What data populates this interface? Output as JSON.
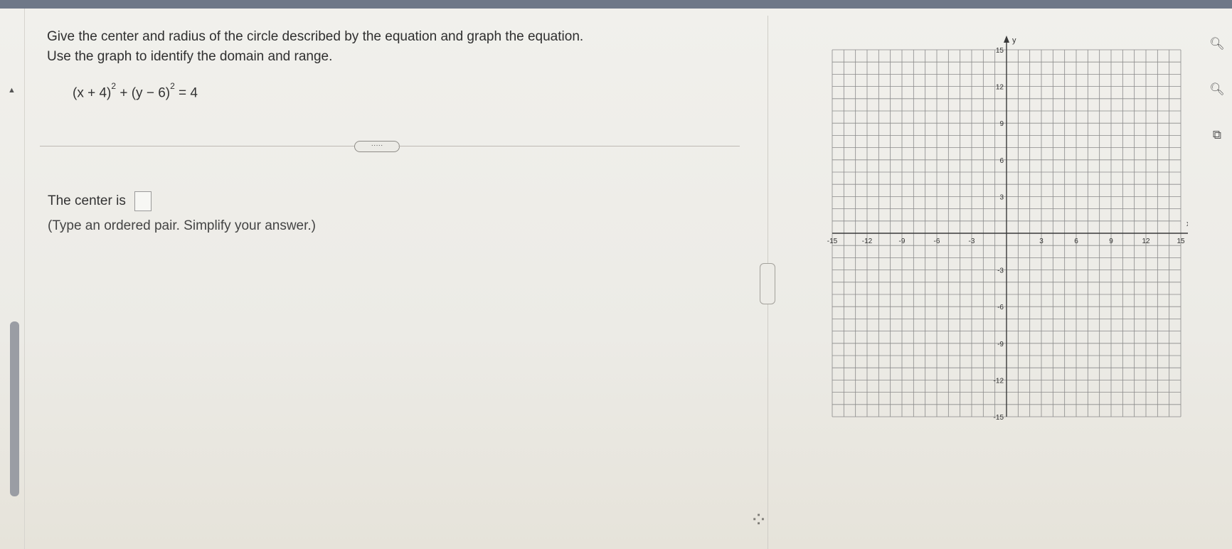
{
  "question": {
    "line1": "Give the center and radius of the circle described by the equation and graph the equation.",
    "line2": "Use the graph to identify the domain and range.",
    "equation": {
      "a": "(x + 4)",
      "exp1": "2",
      "mid": " + (y − 6)",
      "exp2": "2",
      "rhs": " = 4"
    }
  },
  "more_button": "·····",
  "answer": {
    "prompt": "The center is",
    "value": "",
    "hint": "(Type an ordered pair. Simplify your answer.)"
  },
  "graph": {
    "x_axis_label": "x",
    "y_axis_label": "y",
    "x_ticks": [
      {
        "v": -15,
        "label": "-15"
      },
      {
        "v": -12,
        "label": "-12"
      },
      {
        "v": -9,
        "label": "-9"
      },
      {
        "v": -6,
        "label": "-6"
      },
      {
        "v": -3,
        "label": "-3"
      },
      {
        "v": 3,
        "label": "3"
      },
      {
        "v": 6,
        "label": "6"
      },
      {
        "v": 9,
        "label": "9"
      },
      {
        "v": 12,
        "label": "12"
      },
      {
        "v": 15,
        "label": "15"
      }
    ],
    "y_ticks": [
      {
        "v": 15,
        "label": "15"
      },
      {
        "v": 12,
        "label": "12"
      },
      {
        "v": 9,
        "label": "9"
      },
      {
        "v": 6,
        "label": "6"
      },
      {
        "v": 3,
        "label": "3"
      },
      {
        "v": -3,
        "label": "-3"
      },
      {
        "v": -6,
        "label": "-6"
      },
      {
        "v": -9,
        "label": "-9"
      },
      {
        "v": -12,
        "label": "-12"
      },
      {
        "v": -15,
        "label": "-15"
      }
    ],
    "range": [
      -15,
      15
    ]
  },
  "tools": [
    "zoom-in-icon",
    "zoom-out-icon",
    "popout-icon"
  ],
  "colors": {
    "grid": "#8a8a8a",
    "axis": "#3a3a3a",
    "topbar": "#6f7888"
  }
}
